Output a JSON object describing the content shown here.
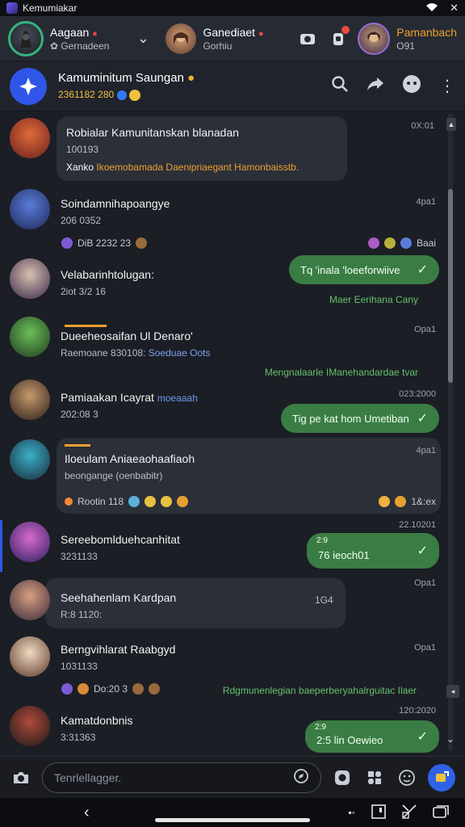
{
  "status_bar": {
    "app_name": "Kemumiakar"
  },
  "accounts": {
    "account1": {
      "name": "Aagaan",
      "sub": "Gernadeen"
    },
    "account2": {
      "name": "Ganediaet",
      "sub": "Gorhiu"
    },
    "account3": {
      "name": "Pamanbach",
      "sub": "O91"
    }
  },
  "header": {
    "title": "Kamuminitum Saungan",
    "sub": "2361182 280"
  },
  "messages": [
    {
      "name": "Robialar Kamunitanskan blanadan",
      "meta": "100193",
      "time": "0X:01",
      "preview": "Ikoemobamada Daenipriaegant Hamonbaisstb.",
      "preview_lead": "Xanko"
    },
    {
      "name": "Soindamnihapoangye",
      "meta": "206 0352",
      "time": "4pa1",
      "reactions_left": "DiB 2232  23",
      "reactions_right": "Baai"
    },
    {
      "name": "Velabarinhtolugan:",
      "meta": "2iot 3/2 16",
      "bubble": "Tq 'inala 'loeeforwiive",
      "note": "Maer Eerihana Cany"
    },
    {
      "name": "Dueeheosaifan Ul Denaro'",
      "meta": "Raemoane 830108:",
      "meta2": "Soeduae Oots",
      "time": "Opa1",
      "note": "Mengnalaarle IManehandardae tvar"
    },
    {
      "name": "Pamiaakan Icayrat",
      "meta": "202:08 3",
      "tag": "moeaaah",
      "time": "023:2000",
      "bubble": "Tig pe kat hom Umetiban"
    },
    {
      "name": "Iloeulam Aniaeaohaafiaoh",
      "meta": "beongange (oenbabitr)",
      "time": "4pa1",
      "footer": "Rootin 118",
      "footer_right": "1&:ex"
    },
    {
      "name": "Sereebomlduehcanhitat",
      "meta": "3231133",
      "time": "22.10201",
      "bubble": "76  ieoch01",
      "bubble_top": "2:9"
    },
    {
      "name": "Seehahenlam Kardpan",
      "meta": "R:8 1120:",
      "time": "Opa1",
      "right_tag": "1G4"
    },
    {
      "name": "Berngvihlarat Raabgyd",
      "meta": "1031133",
      "time": "Opa1",
      "reactions_left": "Do:20  3",
      "note": "Rdgmunenlegian baeperberyahalrguitac Ilaer"
    },
    {
      "name": "Kamatdonbnis",
      "meta": "3:31363",
      "time": "120:2020",
      "bubble": "2:5  lin Oewieo",
      "bubble_top": "2:9"
    }
  ],
  "composer": {
    "placeholder": "Tenrlellagger."
  },
  "colors": {
    "accent_green": "#3a7d44",
    "accent_blue": "#2f56e8",
    "highlight_yellow": "#f0c040",
    "bg": "#1b1e25"
  }
}
